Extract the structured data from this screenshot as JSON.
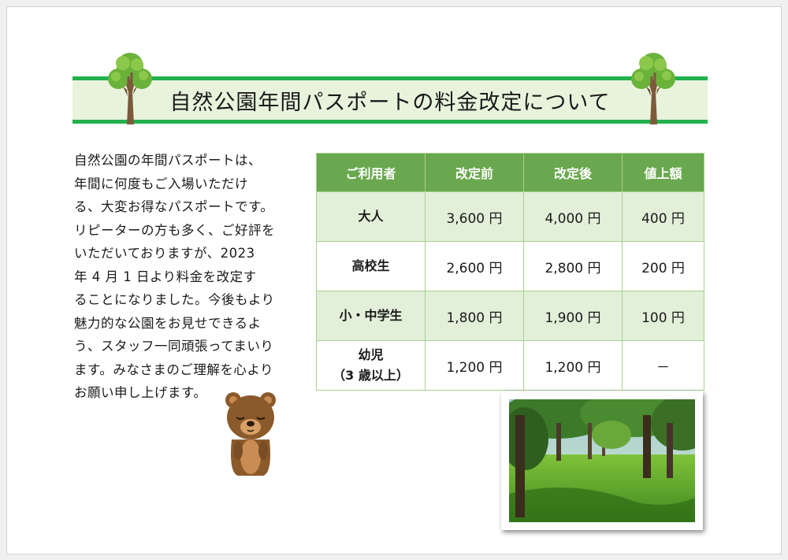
{
  "document": {
    "title": "自然公園年間パスポートの料金改定について",
    "body_lines": [
      "自然公園の年間パスポートは、",
      "年間に何度もご入場いただけ",
      "る、大変お得なパスポートです。",
      "リピーターの方も多く、ご好評を",
      "いただいておりますが、2023",
      "年 4 月 1 日より料金を改定す",
      "ることになりました。今後もより",
      "魅力的な公園をお見せできるよ",
      "う、スタッフ一同頑張ってまいり",
      "ます。みなさまのご理解を心より",
      "お願い申し上げます。"
    ]
  },
  "table": {
    "headers": [
      "ご利用者",
      "改定前",
      "改定後",
      "値上額"
    ],
    "rows": [
      {
        "category": "大人",
        "before": "3,600 円",
        "after": "4,000 円",
        "increase": "400 円"
      },
      {
        "category": "高校生",
        "before": "2,600 円",
        "after": "2,800 円",
        "increase": "200 円"
      },
      {
        "category": "小・中学生",
        "before": "1,800 円",
        "after": "1,900 円",
        "increase": "100 円"
      },
      {
        "category_line1": "幼児",
        "category_line2": "（3 歳以上）",
        "before": "1,200 円",
        "after": "1,200 円",
        "increase": "－"
      }
    ]
  },
  "colors": {
    "banner_line": "#22b14c",
    "banner_fill": "#e8f3dc",
    "table_header": "#6aa84f",
    "table_stripe": "#e2efd9",
    "table_border": "#a9d08e"
  },
  "icons": [
    "tree-icon",
    "bear-illustration",
    "park-photo"
  ]
}
